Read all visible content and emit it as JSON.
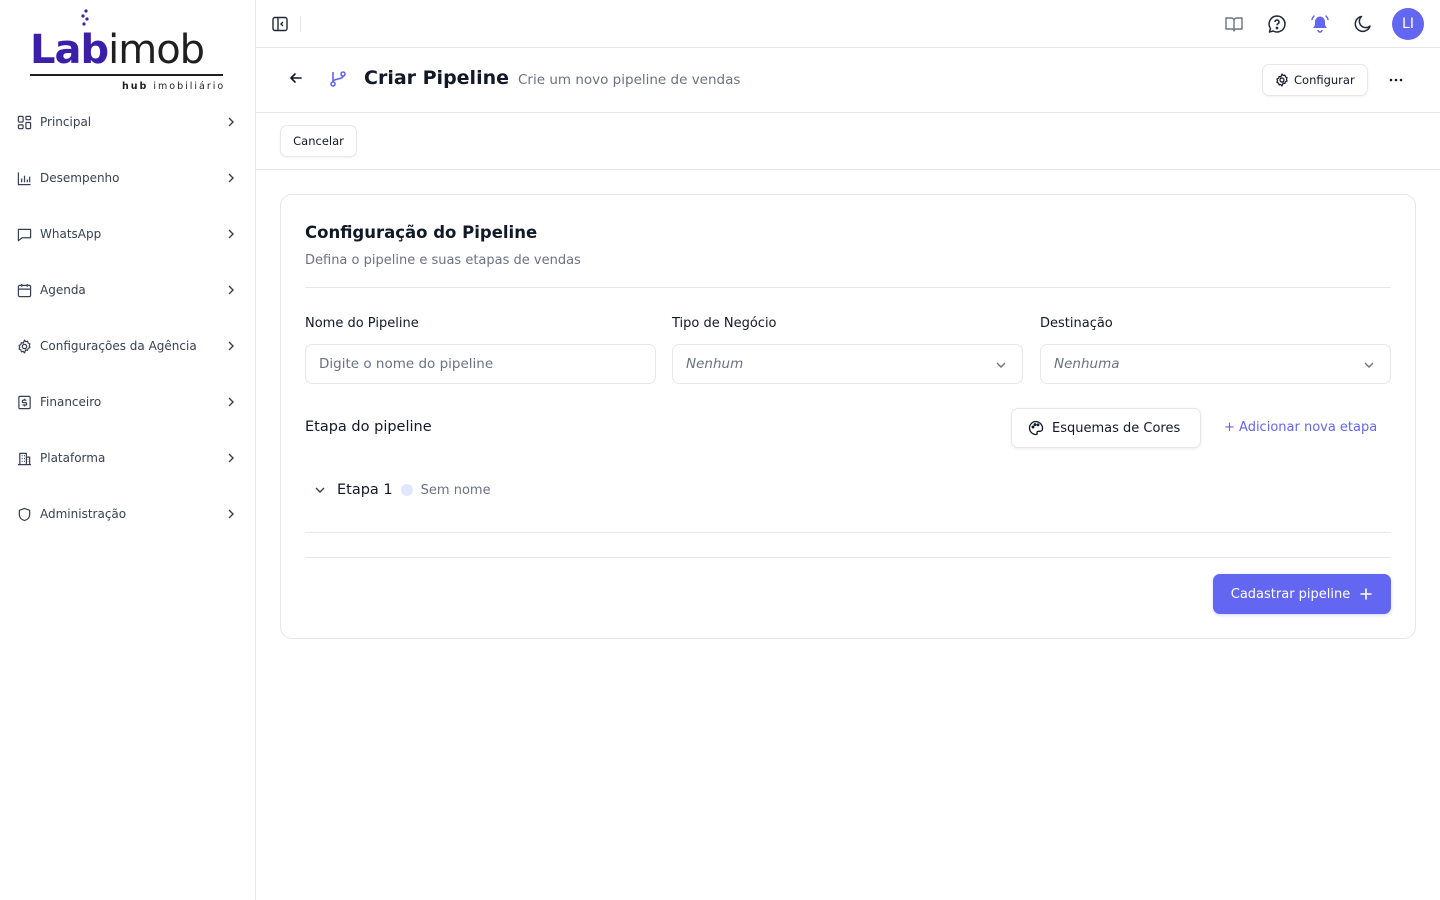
{
  "brand": {
    "logo_bold": "Lab",
    "logo_rest": "imob",
    "tagline_bold": "hub",
    "tagline_rest": "imobiliário",
    "accent_color": "#3b1fa8"
  },
  "sidebar": {
    "items": [
      {
        "label": "Principal",
        "icon": "grid-icon"
      },
      {
        "label": "Desempenho",
        "icon": "bar-chart-icon"
      },
      {
        "label": "WhatsApp",
        "icon": "message-icon"
      },
      {
        "label": "Agenda",
        "icon": "calendar-icon"
      },
      {
        "label": "Configurações da Agência",
        "icon": "gear-icon"
      },
      {
        "label": "Financeiro",
        "icon": "dollar-icon"
      },
      {
        "label": "Plataforma",
        "icon": "building-icon"
      },
      {
        "label": "Administração",
        "icon": "shield-icon"
      }
    ]
  },
  "topbar": {
    "icons": [
      "book-icon",
      "help-chat-icon",
      "bell-ringing-icon",
      "moon-icon"
    ],
    "avatar_initials": "LI",
    "avatar_color": "#6366f1"
  },
  "header": {
    "title": "Criar Pipeline",
    "subtitle": "Crie um novo pipeline de vendas",
    "config_label": "Configurar"
  },
  "actions": {
    "cancel_label": "Cancelar"
  },
  "form": {
    "title": "Configuração do Pipeline",
    "subtitle": "Defina o pipeline e suas etapas de vendas",
    "name_label": "Nome do Pipeline",
    "name_placeholder": "Digite o nome do pipeline",
    "name_value": "",
    "type_label": "Tipo de Negócio",
    "type_value": "Nenhum",
    "destination_label": "Destinação",
    "destination_value": "Nenhuma",
    "stages_title": "Etapa do pipeline",
    "color_schemes_label": "Esquemas de Cores",
    "add_stage_label": "+ Adicionar nova etapa",
    "stages": [
      {
        "name": "Etapa 1",
        "placeholder": "Sem nome",
        "color": "#e0e7ff"
      }
    ],
    "submit_label": "Cadastrar pipeline",
    "primary_color": "#6366f1"
  }
}
